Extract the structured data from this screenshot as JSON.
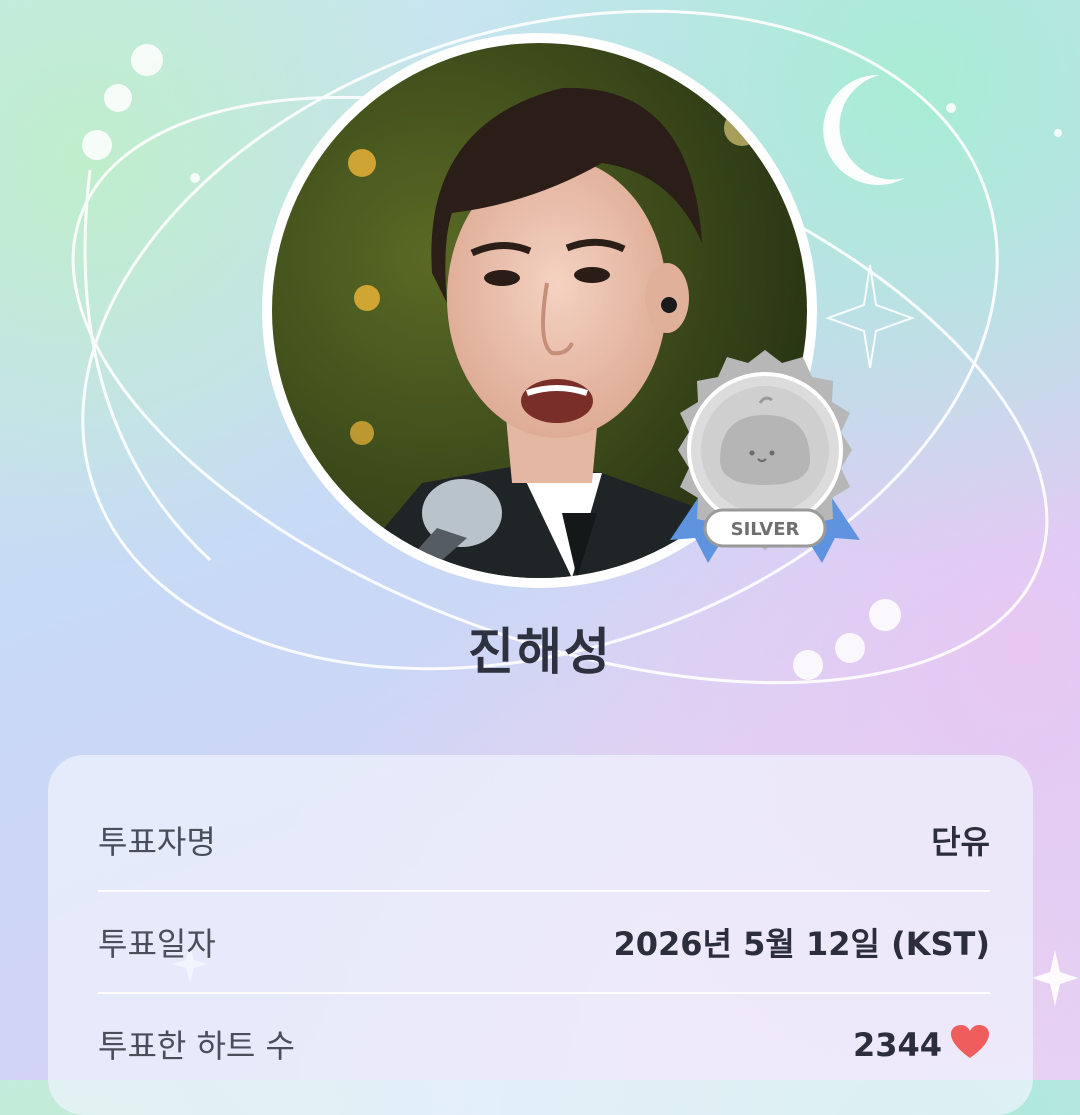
{
  "profile": {
    "name": "진해성",
    "badge_label": "SILVER"
  },
  "details": {
    "voter_label": "투표자명",
    "voter_value": "단유",
    "date_label": "투표일자",
    "date_value": "2026년 5월 12일 (KST)",
    "hearts_label": "투표한 하트 수",
    "hearts_value": "2344"
  },
  "icons": {
    "heart": "heart-icon",
    "moon": "moon-icon",
    "sparkle": "sparkle-icon",
    "medal": "silver-medal-icon"
  },
  "colors": {
    "heart": "#ef5d5d",
    "medal_ribbon": "#5e93e0",
    "medal_silver": "#c9c9c9",
    "text_dark": "#2e3140"
  }
}
